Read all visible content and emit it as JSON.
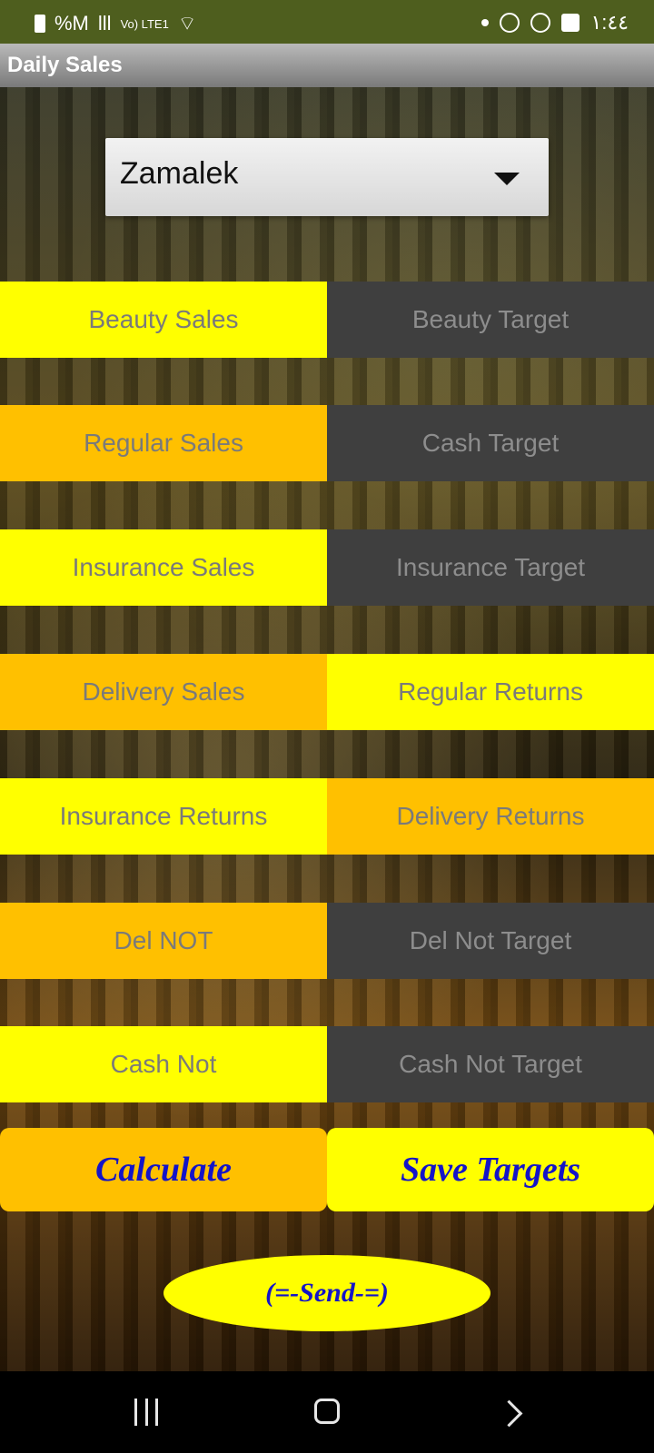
{
  "status_bar": {
    "left_text": "%M",
    "signal": "lll",
    "network": "Vo) LTE1",
    "time": "١:٤٤"
  },
  "app_bar": {
    "title": "Daily Sales"
  },
  "dropdown": {
    "selected": "Zamalek"
  },
  "rows": [
    {
      "left": "Beauty Sales",
      "right": "Beauty Target"
    },
    {
      "left": "Regular Sales",
      "right": "Cash Target"
    },
    {
      "left": "Insurance Sales",
      "right": "Insurance Target"
    },
    {
      "left": "Delivery Sales",
      "right": "Regular Returns"
    },
    {
      "left": "Insurance Returns",
      "right": "Delivery Returns"
    },
    {
      "left": "Del NOT",
      "right": "Del Not Target"
    },
    {
      "left": "Cash Not",
      "right": "Cash Not Target"
    }
  ],
  "actions": {
    "calculate": "Calculate",
    "save_targets": "Save Targets",
    "send": "(=-Send-=)"
  },
  "colors": {
    "yellow": "#ffff00",
    "orange": "#ffc000",
    "dark": "#3f3f3f",
    "button_text": "#1414c8"
  },
  "icons": [
    "battery-icon",
    "signal-icon",
    "wifi-icon",
    "notification-dot-icon",
    "app-icon",
    "whatsapp-icon",
    "gallery-icon",
    "recent-apps-icon",
    "home-icon",
    "back-icon"
  ]
}
